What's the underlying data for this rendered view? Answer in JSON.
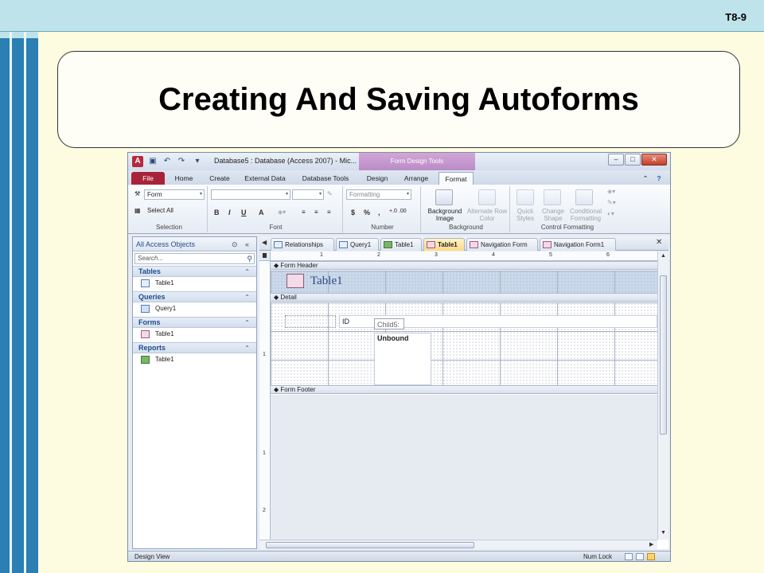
{
  "slide": {
    "number": "T8-9",
    "title": "Creating And Saving Autoforms"
  },
  "window": {
    "title": "Database5 : Database (Access 2007)  -  Mic...",
    "context_tab": "Form Design Tools",
    "ribbon_tabs": [
      "File",
      "Home",
      "Create",
      "External Data",
      "Database Tools",
      "Design",
      "Arrange",
      "Format"
    ],
    "active_tab": "Format"
  },
  "ribbon": {
    "selection": {
      "object_combo": "Form",
      "select_all": "Select All",
      "label": "Selection"
    },
    "font": {
      "label": "Font",
      "bold": "B",
      "italic": "I",
      "underline": "U",
      "font_color": "A"
    },
    "number": {
      "format_combo": "Formatting",
      "currency": "$",
      "percent": "%",
      "comma": ",",
      "inc_dec": "+.0 .00",
      "label": "Number"
    },
    "background": {
      "image_btn": "Background Image",
      "alt_row_btn": "Alternate Row Color",
      "label": "Background"
    },
    "control_formatting": {
      "quick_styles": "Quick Styles",
      "change_shape": "Change Shape",
      "conditional": "Conditional Formatting",
      "label": "Control Formatting"
    }
  },
  "nav": {
    "header": "All Access Objects",
    "search_placeholder": "Search...",
    "groups": [
      {
        "name": "Tables",
        "items": [
          "Table1"
        ]
      },
      {
        "name": "Queries",
        "items": [
          "Query1"
        ]
      },
      {
        "name": "Forms",
        "items": [
          "Table1"
        ]
      },
      {
        "name": "Reports",
        "items": [
          "Table1"
        ]
      }
    ]
  },
  "doc_tabs": [
    "Relationships",
    "Query1",
    "Table1",
    "Table1",
    "Navigation Form",
    "Navigation Form1"
  ],
  "active_doc_tab": 3,
  "design": {
    "ruler_numbers": [
      "1",
      "2",
      "3",
      "4",
      "5",
      "6"
    ],
    "vruler_numbers": [
      "1",
      "1",
      "2"
    ],
    "form_header": "Form Header",
    "form_title": "Table1",
    "detail": "Detail",
    "id_label": "ID",
    "child_label": "Child5:",
    "unbound": "Unbound",
    "form_footer": "Form Footer"
  },
  "status": {
    "left": "Design View",
    "right": "Num Lock"
  }
}
